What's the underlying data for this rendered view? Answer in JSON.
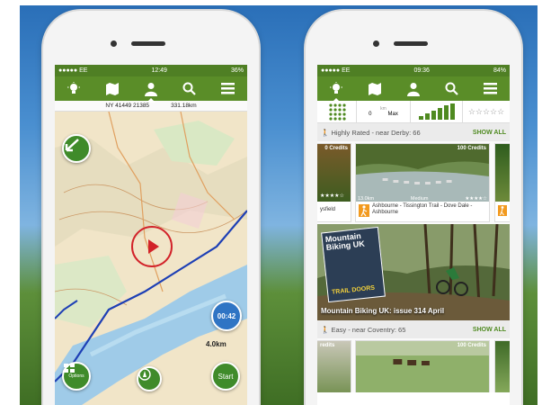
{
  "left_phone": {
    "status": {
      "carrier": "●●●●● EE",
      "time": "12:49",
      "battery": "36%"
    },
    "nav": [
      "tips-icon",
      "map-icon",
      "profile-icon",
      "search-icon",
      "menu-icon"
    ],
    "coords": {
      "grid_ref": "NY 41449 21385",
      "distance": "331.18km"
    },
    "timer": "00:42",
    "scale": "4.0km",
    "options_label": "Options",
    "start_label": "Start"
  },
  "right_phone": {
    "status": {
      "carrier": "●●●●● EE",
      "time": "09:36",
      "battery": "84%"
    },
    "nav": [
      "tips-icon",
      "map-icon",
      "profile-icon",
      "search-icon",
      "menu-icon"
    ],
    "filter": {
      "distance_min": "0",
      "distance_max": "Max",
      "distance_unit": "km"
    },
    "section1": {
      "title": "Highly Rated - near Derby: 66",
      "show_all": "SHOW ALL",
      "left_card": {
        "credits": "0 Credits",
        "title": "ysfield"
      },
      "main_card": {
        "credits": "100 Credits",
        "distance": "13.0km",
        "difficulty": "Medium",
        "title": "Ashbourne - Tissington Trail - Dove Dale - Ashbourne"
      }
    },
    "feature": {
      "caption": "Mountain Biking UK: issue 314 April",
      "mag_title": "Mountain Biking UK",
      "mag_tag": "TRAIL DOORS"
    },
    "section2": {
      "title": "Easy - near Coventry: 65",
      "show_all": "SHOW ALL",
      "left_card": {
        "credits": "redits"
      },
      "main_card": {
        "credits": "100 Credits"
      }
    }
  },
  "colors": {
    "brand_green": "#5a8d28",
    "route_blue": "#1d3fb5",
    "timer_blue": "#2f74c4"
  }
}
